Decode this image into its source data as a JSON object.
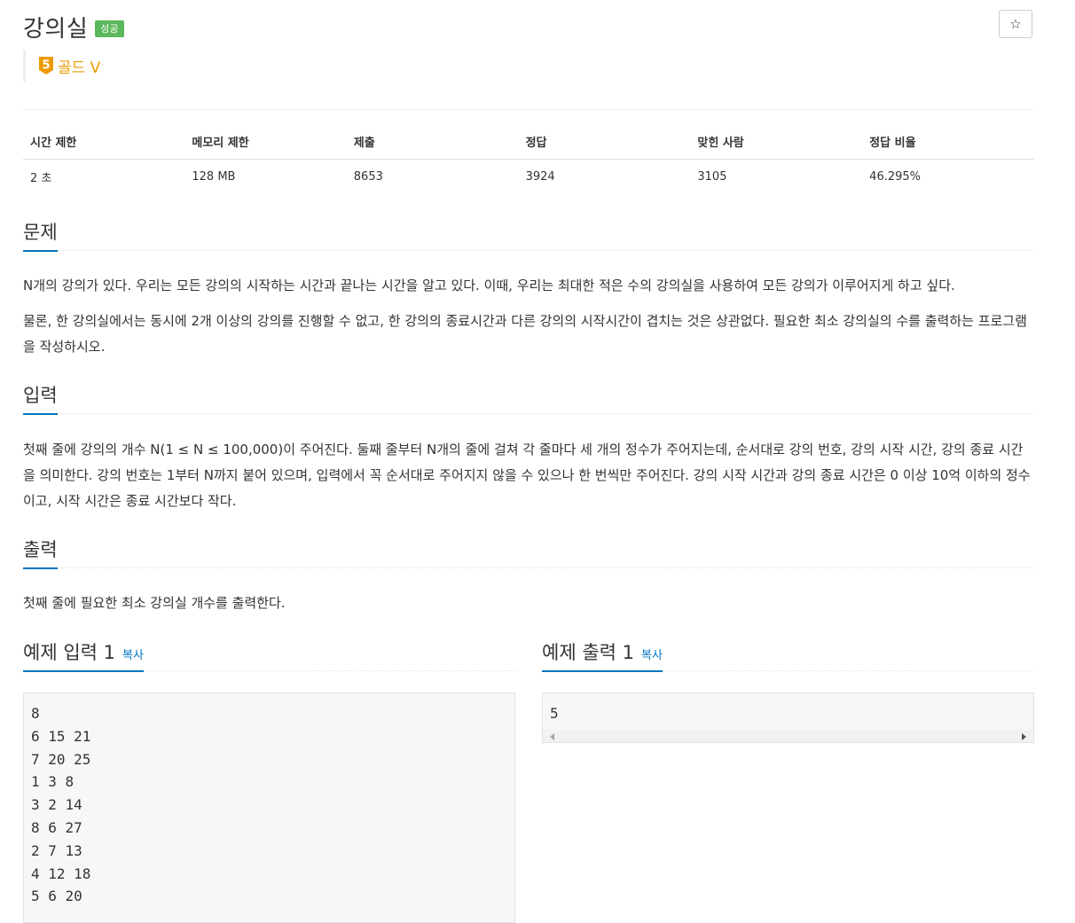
{
  "problem": {
    "title": "강의실",
    "result_badge": "성공",
    "star_icon": "☆",
    "tier": {
      "number": "5",
      "label": "골드 V",
      "color": "#ec9a00"
    }
  },
  "stats": {
    "headers": [
      "시간 제한",
      "메모리 제한",
      "제출",
      "정답",
      "맞힌 사람",
      "정답 비율"
    ],
    "values": [
      "2 초",
      "128 MB",
      "8653",
      "3924",
      "3105",
      "46.295%"
    ]
  },
  "sections": {
    "description": {
      "title": "문제",
      "paragraphs": [
        "N개의 강의가 있다. 우리는 모든 강의의 시작하는 시간과 끝나는 시간을 알고 있다. 이때, 우리는 최대한 적은 수의 강의실을 사용하여 모든 강의가 이루어지게 하고 싶다.",
        "물론, 한 강의실에서는 동시에 2개 이상의 강의를 진행할 수 없고, 한 강의의 종료시간과 다른 강의의 시작시간이 겹치는 것은 상관없다. 필요한 최소 강의실의 수를 출력하는 프로그램을 작성하시오."
      ]
    },
    "input": {
      "title": "입력",
      "paragraphs": [
        "첫째 줄에 강의의 개수 N(1 ≤ N ≤ 100,000)이 주어진다. 둘째 줄부터 N개의 줄에 걸쳐 각 줄마다 세 개의 정수가 주어지는데, 순서대로 강의 번호, 강의 시작 시간, 강의 종료 시간을 의미한다. 강의 번호는 1부터 N까지 붙어 있으며, 입력에서 꼭 순서대로 주어지지 않을 수 있으나 한 번씩만 주어진다. 강의 시작 시간과 강의 종료 시간은 0 이상 10억 이하의 정수이고, 시작 시간은 종료 시간보다 작다."
      ]
    },
    "output": {
      "title": "출력",
      "paragraphs": [
        "첫째 줄에 필요한 최소 강의실 개수를 출력한다."
      ]
    }
  },
  "samples": {
    "input": {
      "title": "예제 입력 1",
      "copy_label": "복사",
      "lines": [
        "8",
        "6 15 21",
        "7 20 25",
        "1 3 8",
        "3 2 14",
        "8 6 27",
        "2 7 13",
        "4 12 18",
        "5 6 20"
      ]
    },
    "output": {
      "title": "예제 출력 1",
      "copy_label": "복사",
      "lines": [
        "5"
      ]
    }
  }
}
